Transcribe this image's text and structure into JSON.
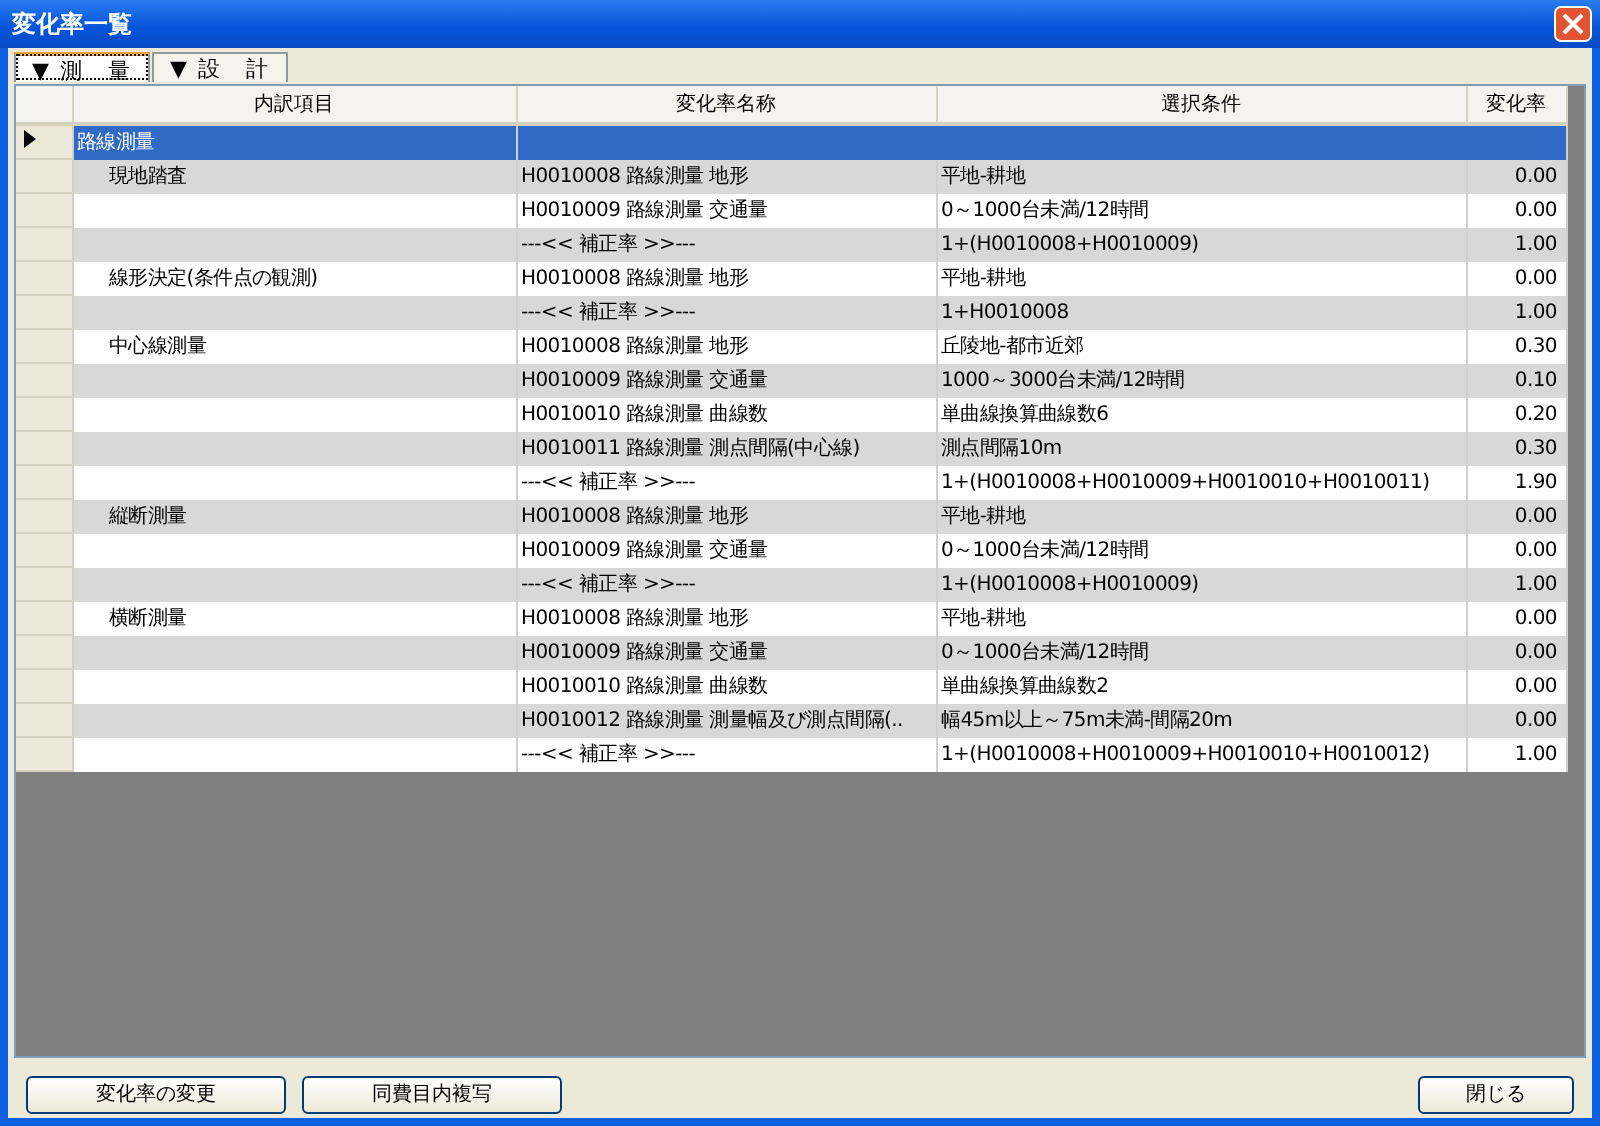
{
  "window": {
    "title": "変化率一覧"
  },
  "tabs": [
    {
      "label": "▼ 測　量",
      "selected": true
    },
    {
      "label": "▼ 設　計",
      "selected": false
    }
  ],
  "table": {
    "columns": [
      "内訳項目",
      "変化率名称",
      "選択条件",
      "変化率"
    ],
    "rows": [
      {
        "kind": "group",
        "item": "路線測量",
        "selected": true
      },
      {
        "kind": "data",
        "item": "現地踏査",
        "name": "H0010008 路線測量 地形",
        "condition": "平地-耕地",
        "rate": "0.00",
        "selected": false
      },
      {
        "kind": "data",
        "name": "H0010009 路線測量 交通量",
        "condition": "0～1000台未満/12時間",
        "rate": "0.00",
        "selected": false
      },
      {
        "kind": "data",
        "name": "---<< 補正率 >>---",
        "condition": "1+(H0010008+H0010009)",
        "rate": "1.00",
        "selected": false
      },
      {
        "kind": "data",
        "item": "線形決定(条件点の観測)",
        "name": "H0010008 路線測量 地形",
        "condition": "平地-耕地",
        "rate": "0.00",
        "selected": false
      },
      {
        "kind": "data",
        "name": "---<< 補正率 >>---",
        "condition": "1+H0010008",
        "rate": "1.00",
        "selected": false
      },
      {
        "kind": "data",
        "item": "中心線測量",
        "name": "H0010008 路線測量 地形",
        "condition": "丘陵地-都市近郊",
        "rate": "0.30",
        "selected": false
      },
      {
        "kind": "data",
        "name": "H0010009 路線測量 交通量",
        "condition": "1000～3000台未満/12時間",
        "rate": "0.10",
        "selected": false
      },
      {
        "kind": "data",
        "name": "H0010010 路線測量 曲線数",
        "condition": "単曲線換算曲線数6",
        "rate": "0.20",
        "selected": false
      },
      {
        "kind": "data",
        "name": "H0010011 路線測量 測点間隔(中心線)",
        "condition": "測点間隔10m",
        "rate": "0.30",
        "selected": false
      },
      {
        "kind": "data",
        "name": "---<< 補正率 >>---",
        "condition": "1+(H0010008+H0010009+H0010010+H0010011)",
        "rate": "1.90",
        "selected": false
      },
      {
        "kind": "data",
        "item": "縦断測量",
        "name": "H0010008 路線測量 地形",
        "condition": "平地-耕地",
        "rate": "0.00",
        "selected": false
      },
      {
        "kind": "data",
        "name": "H0010009 路線測量 交通量",
        "condition": "0～1000台未満/12時間",
        "rate": "0.00",
        "selected": false
      },
      {
        "kind": "data",
        "name": "---<< 補正率 >>---",
        "condition": "1+(H0010008+H0010009)",
        "rate": "1.00",
        "selected": false
      },
      {
        "kind": "data",
        "item": "横断測量",
        "name": "H0010008 路線測量 地形",
        "condition": "平地-耕地",
        "rate": "0.00",
        "selected": false
      },
      {
        "kind": "data",
        "name": "H0010009 路線測量 交通量",
        "condition": "0～1000台未満/12時間",
        "rate": "0.00",
        "selected": false
      },
      {
        "kind": "data",
        "name": "H0010010 路線測量 曲線数",
        "condition": "単曲線換算曲線数2",
        "rate": "0.00",
        "selected": false
      },
      {
        "kind": "data",
        "name": "H0010012 路線測量 測量幅及び測点間隔(..",
        "condition": "幅45m以上～75m未満-間隔20m",
        "rate": "0.00",
        "selected": false
      },
      {
        "kind": "data",
        "name": "---<< 補正率 >>---",
        "condition": "1+(H0010008+H0010009+H0010010+H0010012)",
        "rate": "1.00",
        "selected": false
      }
    ]
  },
  "buttons": [
    {
      "label": "変化率の変更"
    },
    {
      "label": "同費目内複写"
    }
  ],
  "close_button": {
    "label": "閉じる"
  }
}
